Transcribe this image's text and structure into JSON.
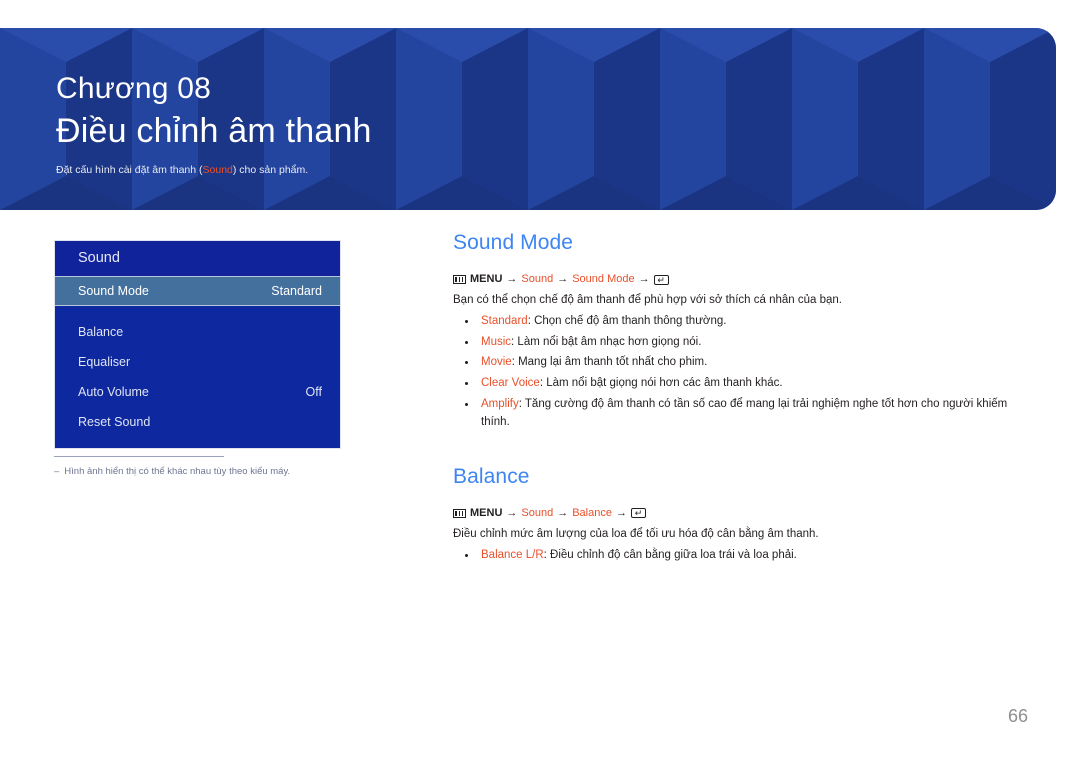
{
  "banner": {
    "chapter": "Chương 08",
    "title": "Điều chỉnh âm thanh",
    "subtitle_pre": "Đặt cấu hình cài đặt âm thanh (",
    "subtitle_highlight": "Sound",
    "subtitle_post": ") cho sản phẩm.",
    "bg_color": "#1f3e96",
    "highlight_color": "#e8502b"
  },
  "osd": {
    "title": "Sound",
    "rows": [
      {
        "label": "Sound Mode",
        "value": "Standard",
        "selected": true
      },
      {
        "label": "Balance",
        "value": "",
        "selected": false
      },
      {
        "label": "Equaliser",
        "value": "",
        "selected": false
      },
      {
        "label": "Auto Volume",
        "value": "Off",
        "selected": false
      },
      {
        "label": "Reset Sound",
        "value": "",
        "selected": false
      }
    ],
    "bg_color": "#0e28a0",
    "selected_color": "#44709e"
  },
  "note": {
    "dash": "‒",
    "text": "Hình ảnh hiển thị có thể khác nhau tùy theo kiểu máy."
  },
  "sections": [
    {
      "heading": "Sound Mode",
      "path": {
        "menu_icon": "menu-icon",
        "menu_label": "MENU",
        "arrow": "→",
        "step1": "Sound",
        "step2": "Sound Mode",
        "enter_icon": "enter-key-icon",
        "enter_glyph": "↵"
      },
      "lead": "Bạn có thể chọn chế độ âm thanh để phù hợp với sở thích cá nhân của bạn.",
      "bullets": [
        {
          "term": "Standard",
          "sep": ":",
          "text": " Chọn chế độ âm thanh thông thường."
        },
        {
          "term": "Music",
          "sep": ":",
          "text": " Làm nổi bật âm nhạc hơn giọng nói."
        },
        {
          "term": "Movie",
          "sep": ":",
          "text": " Mang lại âm thanh tốt nhất cho phim."
        },
        {
          "term": "Clear Voice",
          "sep": ":",
          "text": " Làm nổi bật giọng nói hơn các âm thanh khác."
        },
        {
          "term": "Amplify",
          "sep": ":",
          "text": " Tăng cường độ âm thanh có tần số cao để mang lại trải nghiệm nghe tốt hơn cho người khiếm thính."
        }
      ]
    },
    {
      "heading": "Balance",
      "path": {
        "menu_icon": "menu-icon",
        "menu_label": "MENU",
        "arrow": "→",
        "step1": "Sound",
        "step2": "Balance",
        "enter_icon": "enter-key-icon",
        "enter_glyph": "↵"
      },
      "lead": "Điều chỉnh mức âm lượng của loa để tối ưu hóa độ cân bằng âm thanh.",
      "bullets": [
        {
          "term": "Balance L/R",
          "sep": ":",
          "text": " Điều chỉnh độ cân bằng giữa loa trái và loa phải."
        }
      ]
    }
  ],
  "footer": {
    "page_number": "66"
  },
  "colors": {
    "heading_blue": "#3d85f2",
    "accent_orange": "#e8502b",
    "body_text": "#231f20",
    "page_number": "#8f8f8f"
  }
}
